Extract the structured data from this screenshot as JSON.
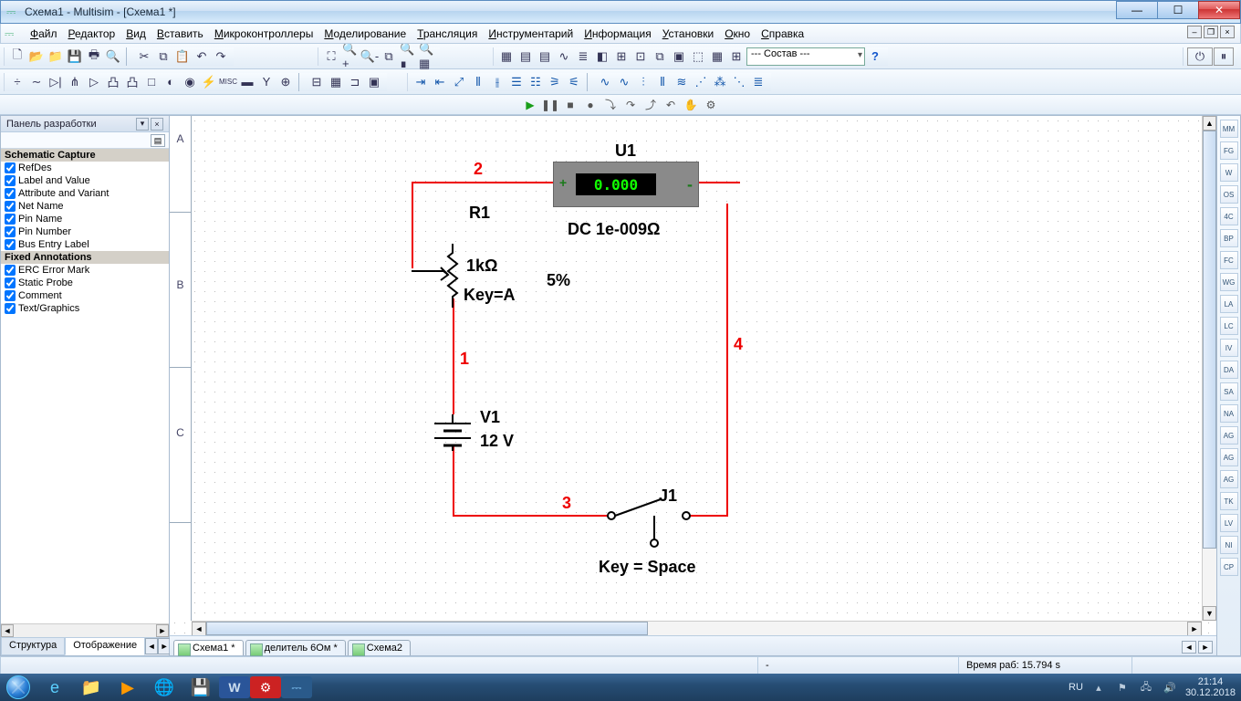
{
  "title": "Схема1 - Multisim - [Схема1 *]",
  "menu": [
    "Файл",
    "Редактор",
    "Вид",
    "Вставить",
    "Микроконтроллеры",
    "Моделирование",
    "Трансляция",
    "Инструментарий",
    "Информация",
    "Установки",
    "Окно",
    "Справка"
  ],
  "combo_compose": "--- Состав ---",
  "sidepanel": {
    "title": "Панель разработки",
    "section1": "Schematic Capture",
    "items1": [
      "RefDes",
      "Label and Value",
      "Attribute and Variant",
      "Net Name",
      "Pin Name",
      "Pin Number",
      "Bus Entry Label"
    ],
    "section2": "Fixed Annotations",
    "items2": [
      "ERC Error Mark",
      "Static Probe",
      "Comment",
      "Text/Graphics"
    ],
    "tab1": "Структура",
    "tab2": "Отображение"
  },
  "ruler": [
    "A",
    "B",
    "C"
  ],
  "schem": {
    "U1": "U1",
    "U1_reading": "0.000",
    "U1_mode": "DC  1e-009Ω",
    "R1": "R1",
    "R1_val": "1kΩ",
    "R1_key": "Key=A",
    "R1_pct": "5%",
    "V1": "V1",
    "V1_val": "12 V",
    "J1": "J1",
    "J1_key": "Key = Space",
    "n1": "1",
    "n2": "2",
    "n3": "3",
    "n4": "4"
  },
  "doctabs": [
    "Схема1 *",
    "делитель 6Ом *",
    "Схема2"
  ],
  "status": {
    "time_label": "Время раб: 15.794 s",
    "dash": "-"
  },
  "tray": {
    "lang": "RU",
    "time": "21:14",
    "date": "30.12.2018"
  }
}
